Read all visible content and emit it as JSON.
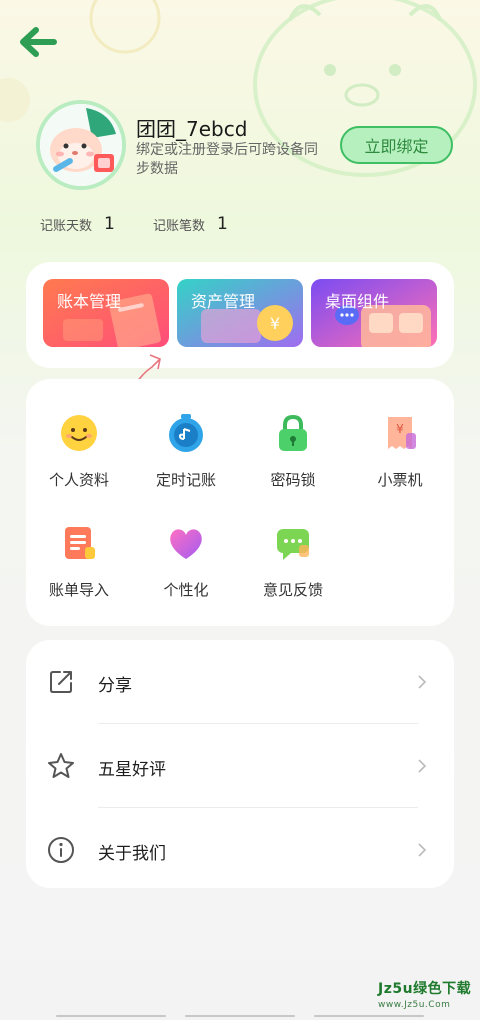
{
  "header": {
    "back_icon": "arrow-left-icon"
  },
  "profile": {
    "username": "团团_7ebcd",
    "bind_hint": "绑定或注册登录后可跨设备同步数据",
    "bind_button": "立即绑定"
  },
  "stats": [
    {
      "label": "记账天数",
      "value": "1"
    },
    {
      "label": "记账笔数",
      "value": "1"
    }
  ],
  "feature_tiles": [
    {
      "label": "账本管理",
      "color": "#ff6a4f"
    },
    {
      "label": "资产管理",
      "color": "#3ac9c2"
    },
    {
      "label": "桌面组件",
      "color": "#8e4cf0"
    }
  ],
  "grid": [
    {
      "label": "个人资料",
      "icon": "smiley-face-icon"
    },
    {
      "label": "定时记账",
      "icon": "timer-clock-icon"
    },
    {
      "label": "密码锁",
      "icon": "padlock-icon"
    },
    {
      "label": "小票机",
      "icon": "receipt-icon"
    },
    {
      "label": "账单导入",
      "icon": "document-import-icon"
    },
    {
      "label": "个性化",
      "icon": "heart-icon"
    },
    {
      "label": "意见反馈",
      "icon": "chat-bubble-icon"
    }
  ],
  "list": [
    {
      "label": "分享",
      "icon": "share-icon"
    },
    {
      "label": "五星好评",
      "icon": "star-icon"
    },
    {
      "label": "关于我们",
      "icon": "info-icon"
    }
  ],
  "watermark": {
    "main": "Jz5u绿色下载",
    "sub": "www.Jz5u.Com"
  },
  "colors": {
    "accent_green": "#3fbf63",
    "back_arrow": "#2f9e55"
  }
}
